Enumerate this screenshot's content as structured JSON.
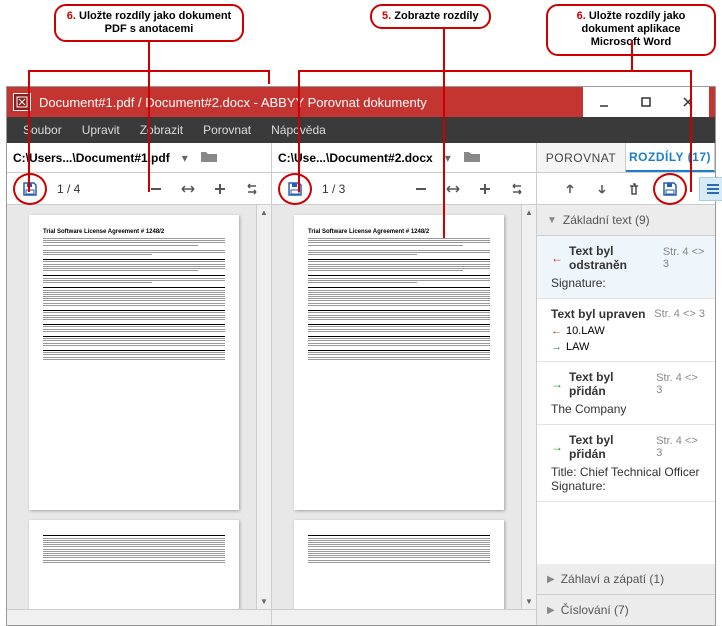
{
  "callouts": {
    "left": {
      "num": "6.",
      "text": "Uložte rozdíly jako dokument PDF s anotacemi"
    },
    "mid": {
      "num": "5.",
      "text": "Zobrazte rozdíly"
    },
    "right": {
      "num": "6.",
      "text": "Uložte rozdíly jako dokument aplikace Microsoft Word"
    }
  },
  "window": {
    "title": "Document#1.pdf / Document#2.docx - ABBYY Porovnat dokumenty"
  },
  "menu": {
    "file": "Soubor",
    "edit": "Upravit",
    "view": "Zobrazit",
    "compare": "Porovnat",
    "help": "Nápověda"
  },
  "paths": {
    "left": "C:\\Users...\\Document#1.pdf",
    "right": "C:\\Use...\\Document#2.docx"
  },
  "tabs": {
    "compare": "POROVNAT",
    "diffs": "ROZDÍLY (17)"
  },
  "pager": {
    "left": "1 / 4",
    "right": "1 / 3"
  },
  "doc": {
    "heading": "Trial Software License Agreement # 1248/2"
  },
  "groups": {
    "body": "Základní text (9)",
    "header": "Záhlaví a zápatí (1)",
    "number": "Číslování (7)"
  },
  "diffs": {
    "removed": {
      "title": "Text byl odstraněn",
      "loc": "Str. 4 <> 3",
      "body": "Signature:"
    },
    "edited": {
      "title": "Text byl upraven",
      "loc": "Str. 4 <> 3",
      "from": "10.LAW",
      "to": "LAW"
    },
    "added1": {
      "title": "Text byl přidán",
      "loc": "Str. 4 <> 3",
      "body": "The Company"
    },
    "added2": {
      "title": "Text byl přidán",
      "loc": "Str. 4 <> 3",
      "body": "Title: Chief Technical Officer Signature:"
    }
  }
}
